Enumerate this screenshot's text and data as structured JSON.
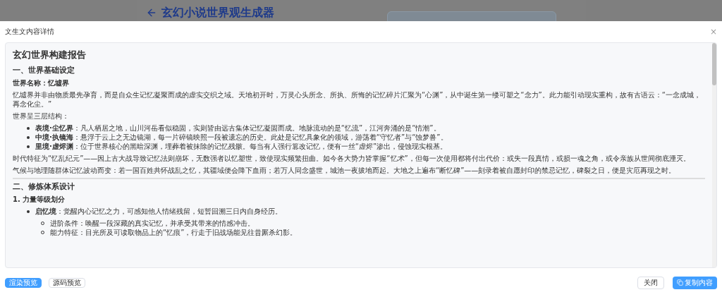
{
  "background": {
    "title": "玄幻小说世界观生成器"
  },
  "modal": {
    "title": "文生文内容详情",
    "close": "×",
    "blocks": [
      {
        "kind": "h1",
        "text": "玄幻世界构建报告"
      },
      {
        "kind": "h2",
        "text": "一、世界基础设定"
      },
      {
        "kind": "label",
        "text": "世界名称：忆墟界"
      },
      {
        "kind": "p",
        "text": "忆墟界并非由物质最先孕育，而是自众生记忆凝聚而成的虚实交织之域。天地初开时，万灵心头所念、所执、所悔的记忆碎片汇聚为“心渊”，从中诞生第一缕可塑之“念力”。此力能引动现实重构，故有古语云：“一念成城，再念化尘。”"
      },
      {
        "kind": "p",
        "text": "世界呈三层结构："
      },
      {
        "kind": "ul",
        "items": [
          {
            "text": "**表境·尘忆界**：凡人栖居之地，山川河岳看似稳固，实则皆由远古集体记忆凝固而成。地脉流动的是“忆流”，江河奔涌的是“情潮”。"
          },
          {
            "text": "**中境·执镜海**：悬浮于云上之无边镜湖，每一片碎镜映照一段被遗忘的历史。此处是记忆具象化的领域，游荡着“守忆者”与“蚀梦兽”。"
          },
          {
            "text": "**里境·虚烬渊**：位于世界核心的黑暗深渊，埋葬着被抹除的记忆残骸。每当有人强行篡改记忆，便有一丝“虚烬”渗出，侵蚀现实根基。"
          }
        ]
      },
      {
        "kind": "p",
        "text": "时代特征为“忆乱纪元”——因上古大战导致记忆法则崩坏，无数强者以忆塑世，致使现实频繁扭曲。如今各大势力皆掌握“忆术”，但每一次使用都将付出代价：或失一段真情，或损一魂之角，或令亲族从世间彻底湮灭。"
      },
      {
        "kind": "p",
        "text": "气候与地理随群体记忆波动而变：若一国百姓共怀战乱之忆，其疆域便会降下血雨；若万人同念盛世，城池一夜拔地而起。大地之上遍布“断忆碑”——刻录着被自愿封印的禁忌记忆，碑裂之日，便是灾厄再现之时。"
      },
      {
        "kind": "hr"
      },
      {
        "kind": "h2",
        "text": "二、修炼体系设计"
      },
      {
        "kind": "h3",
        "text": "1. 力量等级划分"
      },
      {
        "kind": "ul",
        "items": [
          {
            "text": "**启忆境**：觉醒内心记忆之力，可感知他人情绪残留，短暂回溯三日内自身经历。",
            "children": [
              {
                "text": "进阶条件：唤醒一段深藏的真实记忆，并承受其带来的情感冲击。"
              },
              {
                "text": "能力特征：目光所及可读取物品上的“忆痕”，行走于旧战场能见往昔厮杀幻影。"
              }
            ]
          }
        ]
      }
    ]
  },
  "footer": {
    "view_tabs": [
      {
        "label": "渲染预览",
        "selected": true
      },
      {
        "label": "源码预览",
        "selected": false
      }
    ],
    "close_button": "关闭",
    "copy_button": "复制内容"
  }
}
